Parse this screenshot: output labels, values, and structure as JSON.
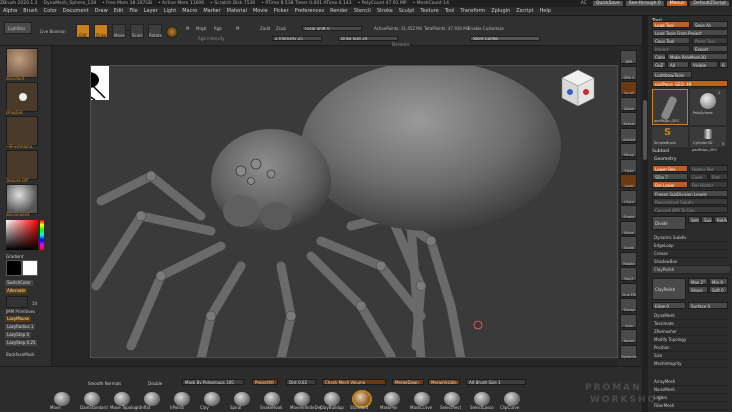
{
  "titlebar": {
    "items": [
      "ZBrush 2020.1.3",
      "DynaMesh_Sphere_128",
      "• Free Mem 38.197GB",
      "• Active Mem 11606",
      "• Scratch Disk 7536",
      "• RTime 8.538 Timer 0.001 ATime 0.143",
      "• PolyCount 47.91 MP",
      "• MeshCount 14"
    ],
    "ac": "AC",
    "quicksave": "QuickSave",
    "seethrough": "See-through  0",
    "menus": "Menus",
    "script": "DefaultZScript"
  },
  "menubar": [
    "Alpha",
    "Brush",
    "Color",
    "Document",
    "Draw",
    "Edit",
    "File",
    "Layer",
    "Light",
    "Macro",
    "Marker",
    "Material",
    "Movie",
    "Picker",
    "Preferences",
    "Render",
    "Stencil",
    "Stroke",
    "Sculpt",
    "Texture",
    "Tool",
    "Transform",
    "Zplugin",
    "Zscript",
    "Help"
  ],
  "toolbar": {
    "lightbox": "LightBox",
    "live_boolean": "Live Boolean",
    "edit": "Edit",
    "draw": "Draw",
    "move": "Move",
    "scale": "Scale",
    "rotate": "Rotate",
    "mrgb": "Mrgb",
    "rgb": "Rgb",
    "m": "M",
    "zadd": "Zadd",
    "zsub": "Zsub",
    "focal": "Focal Shift 0",
    "draw_size": "Draw Size 24",
    "rgb_intensity": "Rgb Intensity",
    "z_intensity": "Z Intensity 25",
    "active_points": "ActivePoints: 11.452 Mil",
    "total_points": "TotalPoints: 47.910 Mil",
    "enable_customize": "Enable Customize",
    "store_config": "Store Config",
    "dynamic": "Dynamic"
  },
  "left": {
    "standard": "Standard",
    "dragdot": "DragDot",
    "alpha_off": "~BrushAlpha",
    "texture_off": "Texture Off",
    "skin_shade": "SkinShade4",
    "gradient": "Gradient",
    "switch_color": "SwitchColor",
    "alternate": "Alternate",
    "backface": "BackfaceMask",
    "lazy_mouse": "LazyMouse",
    "lazy_radius": "LazyRadius 1",
    "lazy_step": "LazyStep 0",
    "lazy_smooth": "LazyStep 0.25",
    "jmm": "JMM Primitives",
    "num14": "14",
    "accent": "#c8811c"
  },
  "right_icons": [
    "BPR",
    "SPix 3",
    "Scroll",
    "Zoom",
    "Actual",
    "AAHalf",
    "Persp",
    "Floor",
    "Local",
    "LSym",
    "Frame",
    "Move",
    "Scale",
    "Rotate",
    "PolyF",
    "Line Fill",
    "Transp",
    "Solo",
    "Xpose",
    "Dynamic"
  ],
  "tool": {
    "title": "Tool",
    "load_tool": "Load Tool",
    "save_as": "Save As",
    "load_from_project": "Load Tools From Project",
    "copy_tool": "Copy Tool",
    "paste_tool": "Paste Tool",
    "import": "Import",
    "export": "Export",
    "clone": "Clone",
    "make_polymesh": "Make PolyMesh3D",
    "goz": "GoZ",
    "all": "All",
    "visible": "Visible",
    "r": "R",
    "lightbox_tools": "Lightbox▸Tools",
    "current_tool": "pedPalps_GEO: 49",
    "tools": [
      "pedPalps_GEO",
      "PolySphere",
      "SimpleBrush",
      "Cylinder3D",
      "pedPalps_GEO"
    ],
    "num2": "2",
    "num5": "5",
    "subtool": "Subtool",
    "geometry": "Geometry",
    "lower_res": "Lower Res",
    "higher_res": "Higher Res",
    "sdiv": "SDiv 7",
    "cage": "Cage",
    "rstr": "Rstr",
    "del_lower": "Del Lower",
    "del_higher": "Del Higher",
    "freeze_sub": "Freeze SubDivision Levels",
    "reconstruct": "Reconstruct Subdiv",
    "convert_bpr": "Convert BPR To Geo",
    "divide": "Divide",
    "smt": "Smt",
    "suv": "Suv",
    "reuv": "ReUV",
    "items": [
      "Dynamic Subdiv",
      "EdgeLoop",
      "Crease",
      "ShadowBox",
      "ClayPolish"
    ],
    "claypolish_btn": "ClayPolish",
    "max": "Max 2°",
    "min": "Min 0",
    "sharp": "Sharp",
    "soft": "Soft 0",
    "edge": "Edge 0",
    "surface": "Surface 0",
    "items2": [
      "DynaMesh",
      "Tessimate",
      "ZRemesher",
      "Modify Topology",
      "Position",
      "Size",
      "MeshIntegrity"
    ],
    "bottom_items": [
      "ArrayMesh",
      "NanoMesh",
      "Layers",
      "FiberMesh"
    ]
  },
  "bottom": {
    "smooth_normals": "Smooth Normals",
    "double": "Double",
    "mask_by_poly": "Mask By Polygroups 100",
    "projectall": "ProjectAll",
    "dist": "Dist 0.02",
    "check_mesh": "Check Mesh Volume",
    "merge_down": "MergeDown",
    "merge_visible": "MergeVisible",
    "alt_brush": "Alt Brush Size 1",
    "brushes": [
      "Move",
      "DamStandard",
      "Move Topologic",
      "Inflat",
      "hPolish",
      "Clay",
      "Spiral",
      "SnakeHook",
      "MoveInfiniteDep",
      "ClayBuildup",
      "Standard",
      "MaskPen",
      "MaskCurve",
      "SelectRect",
      "SelectLasso",
      "ClipCurve"
    ],
    "watermark_top": "PROMAN",
    "watermark_bottom": "WORKSHOP"
  }
}
